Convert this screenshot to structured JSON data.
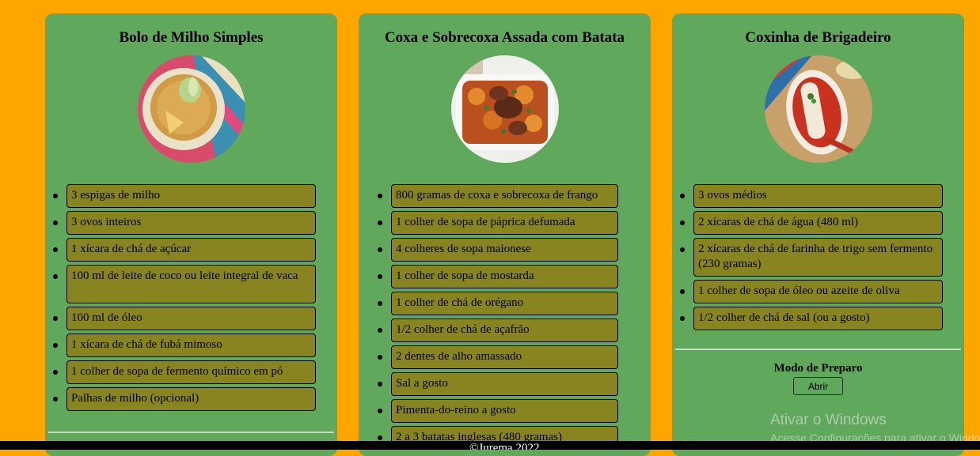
{
  "cards": [
    {
      "title": "Bolo de Milho Simples",
      "image": "corn-cake-photo",
      "ingredients": [
        "3 espigas de milho",
        "3 ovos inteiros",
        "1 xícara de chá de açúcar",
        "100 ml de leite de coco ou leite integral de vaca",
        "100 ml de óleo",
        "1 xícara de chá de fubá mimoso",
        "1 colher de sopa de fermento químico em pó",
        "Palhas de milho (opcional)"
      ]
    },
    {
      "title": "Coxa e Sobrecoxa Assada com Batata",
      "image": "roasted-chicken-potato-photo",
      "ingredients": [
        "800 gramas de coxa e sobrecoxa de frango",
        "1 colher de sopa de páprica defumada",
        "4 colheres de sopa maionese",
        "1 colher de sopa de mostarda",
        "1 colher de chá de orégano",
        "1/2 colher de chá de açafrão",
        "2 dentes de alho amassado",
        "Sal a gosto",
        "Pimenta-do-reino a gosto",
        "2 a 3 batatas inglesas (480 gramas)"
      ]
    },
    {
      "title": "Coxinha de Brigadeiro",
      "image": "coxinha-brigadeiro-photo",
      "ingredients": [
        "3 ovos médios",
        "2 xícaras de chá de água (480 ml)",
        "2 xícaras de chá de farinha de trigo sem fermento (230 gramas)",
        "1 colher de sopa de óleo ou azeite de oliva",
        "1/2 colher de chá de sal (ou a gosto)"
      ],
      "modo_label": "Modo de Preparo",
      "button_label": "Abrir"
    }
  ],
  "footer": "©Jurema 2022",
  "watermark": {
    "title": "Ativar o Windows",
    "subtitle": "Acesse Configurações para ativar o Windows."
  }
}
